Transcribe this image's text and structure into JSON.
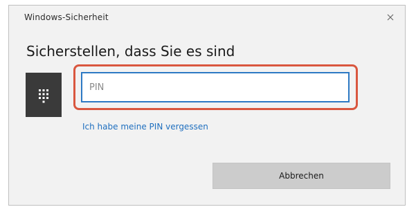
{
  "window": {
    "title": "Windows-Sicherheit",
    "close_icon": "close-icon"
  },
  "main": {
    "heading": "Sicherstellen, dass Sie es sind",
    "pin_icon": "keypad-icon",
    "pin_placeholder": "PIN",
    "pin_value": "",
    "links": {
      "forgot_pin": "Ich habe meine PIN vergessen"
    }
  },
  "footer": {
    "cancel_label": "Abbrechen"
  },
  "colors": {
    "focus_ring": "#d9573f",
    "input_border": "#2d79c4",
    "link": "#1f6fbf",
    "icon_bg": "#3a3a3a",
    "button_bg": "#cccccc"
  }
}
